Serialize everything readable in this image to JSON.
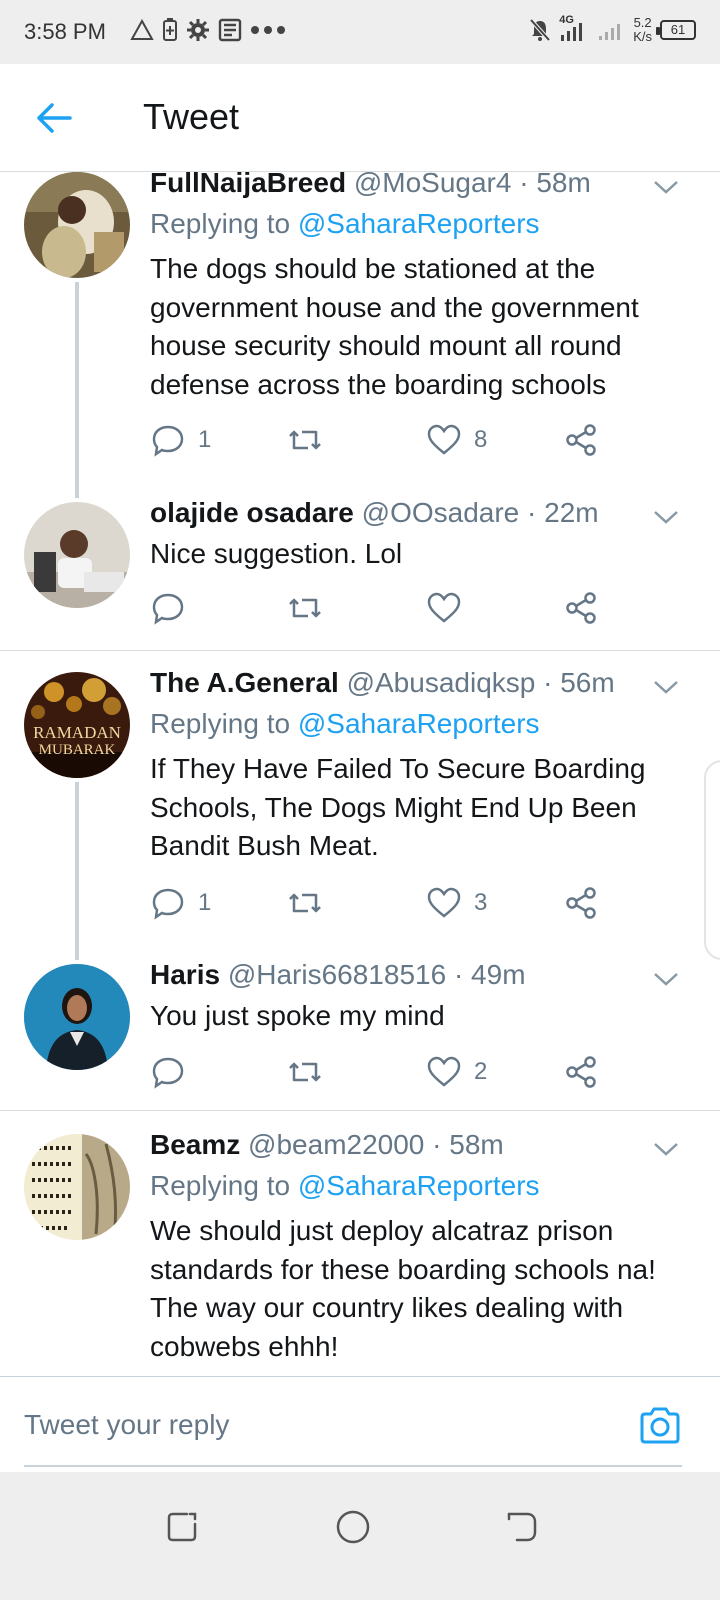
{
  "status_bar": {
    "time": "3:58 PM",
    "left_icons": [
      "warning-icon",
      "battery-saver-icon",
      "settings-icon",
      "news-icon",
      "more-dots-icon"
    ],
    "network": "4G",
    "speed_value": "5.2",
    "speed_unit": "K/s",
    "battery": "61"
  },
  "header": {
    "title": "Tweet"
  },
  "tweets": [
    {
      "name": "FullNaijaBreed",
      "handle": "@MoSugar4 · 58m",
      "replying_prefix": "Replying to ",
      "replying_to": "@SaharaReporters",
      "text": "The dogs should be stationed at the government house and the government house security should mount all round defense across the boarding schools",
      "replies": "1",
      "retweets": "",
      "likes": "8"
    },
    {
      "name": "olajide osadare",
      "handle": "@OOsadare · 22m",
      "text": "Nice suggestion. Lol",
      "replies": "",
      "retweets": "",
      "likes": ""
    },
    {
      "name": "The A.General",
      "handle": "@Abusadiqksp · 56m",
      "replying_prefix": "Replying to ",
      "replying_to": "@SaharaReporters",
      "text": "If They Have Failed To Secure Boarding Schools, The Dogs Might End Up Been Bandit Bush Meat.",
      "avatar_text_1": "RAMADAN",
      "avatar_text_2": "MUBARAK",
      "replies": "1",
      "retweets": "",
      "likes": "3"
    },
    {
      "name": "Haris",
      "handle": "@Haris66818516 · 49m",
      "text": "You just spoke my mind",
      "replies": "",
      "retweets": "",
      "likes": "2"
    },
    {
      "name": "Beamz",
      "handle": "@beam22000 · 58m",
      "replying_prefix": "Replying to ",
      "replying_to": "@SaharaReporters",
      "text": "We should just deploy alcatraz prison standards for these boarding schools na! The way our country likes dealing with cobwebs ehhh!"
    }
  ],
  "reply_bar": {
    "placeholder": "Tweet your reply"
  },
  "colors": {
    "accent": "#1da1f2",
    "secondary_text": "#657786",
    "primary_text": "#14171a",
    "divider": "#d9dde0"
  }
}
